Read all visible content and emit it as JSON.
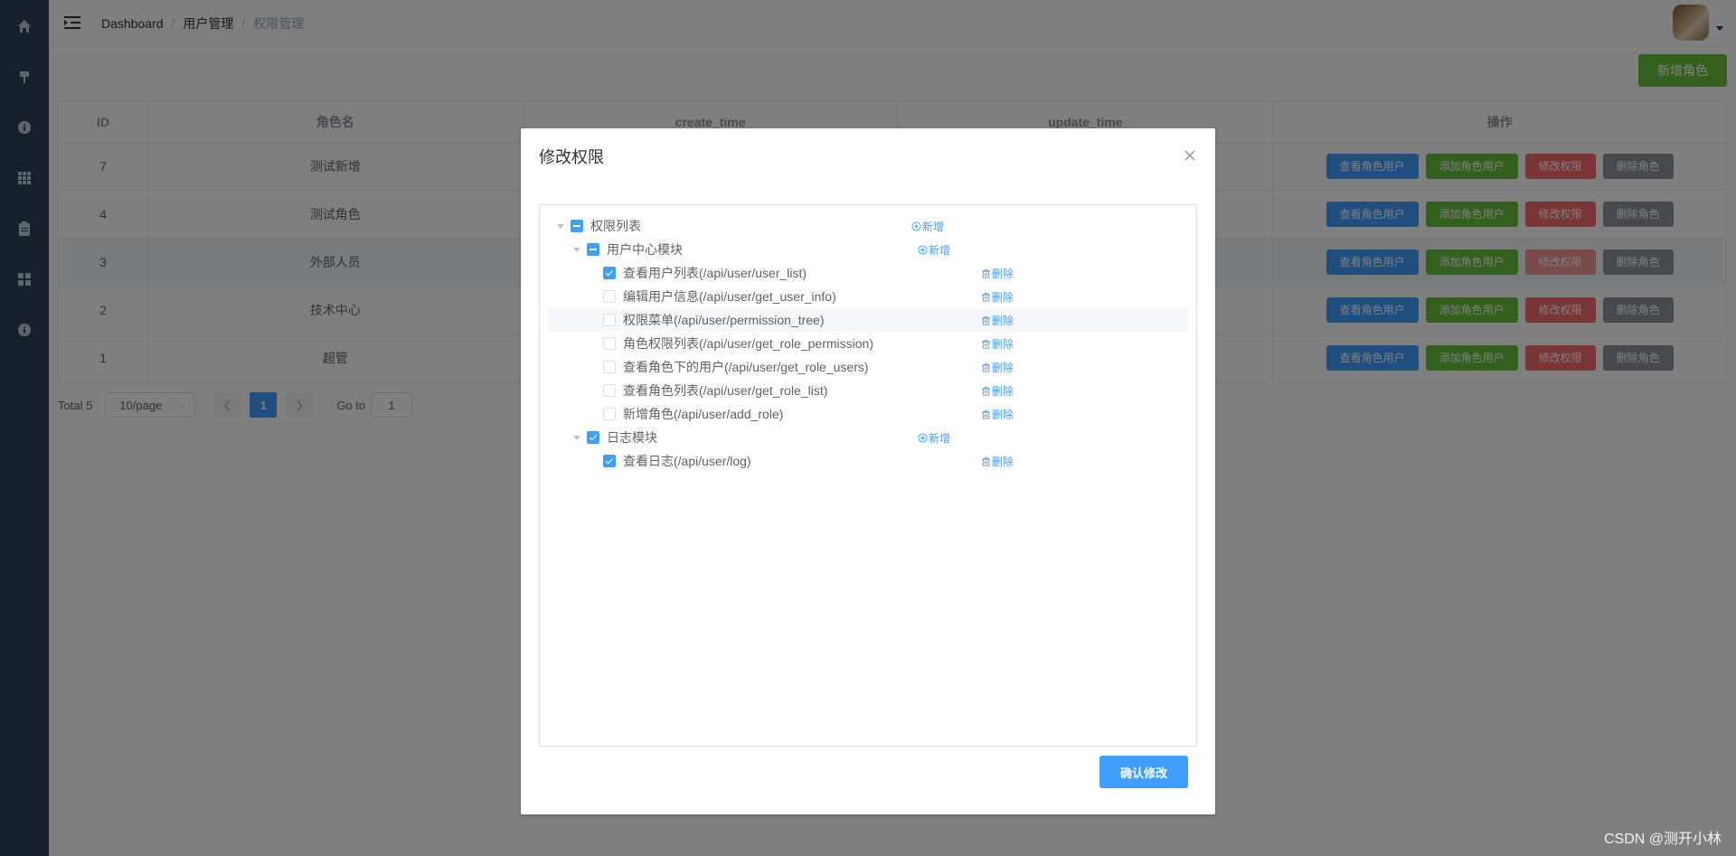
{
  "sidebar": {
    "icons": [
      "home-icon",
      "hammer-icon",
      "info-icon",
      "grid-icon",
      "clipboard-icon",
      "apps-icon",
      "info-icon"
    ]
  },
  "navbar": {
    "breadcrumb": [
      "Dashboard",
      "用户管理",
      "权限管理"
    ]
  },
  "main": {
    "add_role_label": "新增角色",
    "table": {
      "headers": [
        "ID",
        "角色名",
        "create_time",
        "update_time",
        "操作"
      ],
      "rows": [
        {
          "id": "7",
          "name": "测试新增"
        },
        {
          "id": "4",
          "name": "测试角色"
        },
        {
          "id": "3",
          "name": "外部人员"
        },
        {
          "id": "2",
          "name": "技术中心"
        },
        {
          "id": "1",
          "name": "超管"
        }
      ],
      "actions": [
        "查看角色用户",
        "添加角色用户",
        "修改权限",
        "删除角色"
      ]
    },
    "pagination": {
      "total": "Total 5",
      "page_size": "10/page",
      "current_page": "1",
      "goto_label": "Go to",
      "goto_value": "1"
    }
  },
  "dialog": {
    "title": "修改权限",
    "tree": {
      "root": {
        "label": "权限列表",
        "action": "新增",
        "state": "indeterminate"
      },
      "modules": [
        {
          "label": "用户中心模块",
          "action": "新增",
          "state": "indeterminate",
          "children": [
            {
              "label": "查看用户列表(/api/user/user_list)",
              "action": "删除",
              "checked": true
            },
            {
              "label": "编辑用户信息(/api/user/get_user_info)",
              "action": "删除",
              "checked": false
            },
            {
              "label": "权限菜单(/api/user/permission_tree)",
              "action": "删除",
              "checked": false
            },
            {
              "label": "角色权限列表(/api/user/get_role_permission)",
              "action": "删除",
              "checked": false
            },
            {
              "label": "查看角色下的用户(/api/user/get_role_users)",
              "action": "删除",
              "checked": false
            },
            {
              "label": "查看角色列表(/api/user/get_role_list)",
              "action": "删除",
              "checked": false
            },
            {
              "label": "新增角色(/api/user/add_role)",
              "action": "删除",
              "checked": false
            }
          ]
        },
        {
          "label": "日志模块",
          "action": "新增",
          "state": "checked",
          "children": [
            {
              "label": "查看日志(/api/user/log)",
              "action": "删除",
              "checked": true
            }
          ]
        }
      ]
    },
    "confirm_label": "确认修改"
  },
  "watermark": "CSDN @测开小林",
  "colors": {
    "sidebar": "#304156",
    "primary": "#409eff",
    "success": "#67c23a",
    "danger": "#f56c6c",
    "info": "#909399"
  }
}
